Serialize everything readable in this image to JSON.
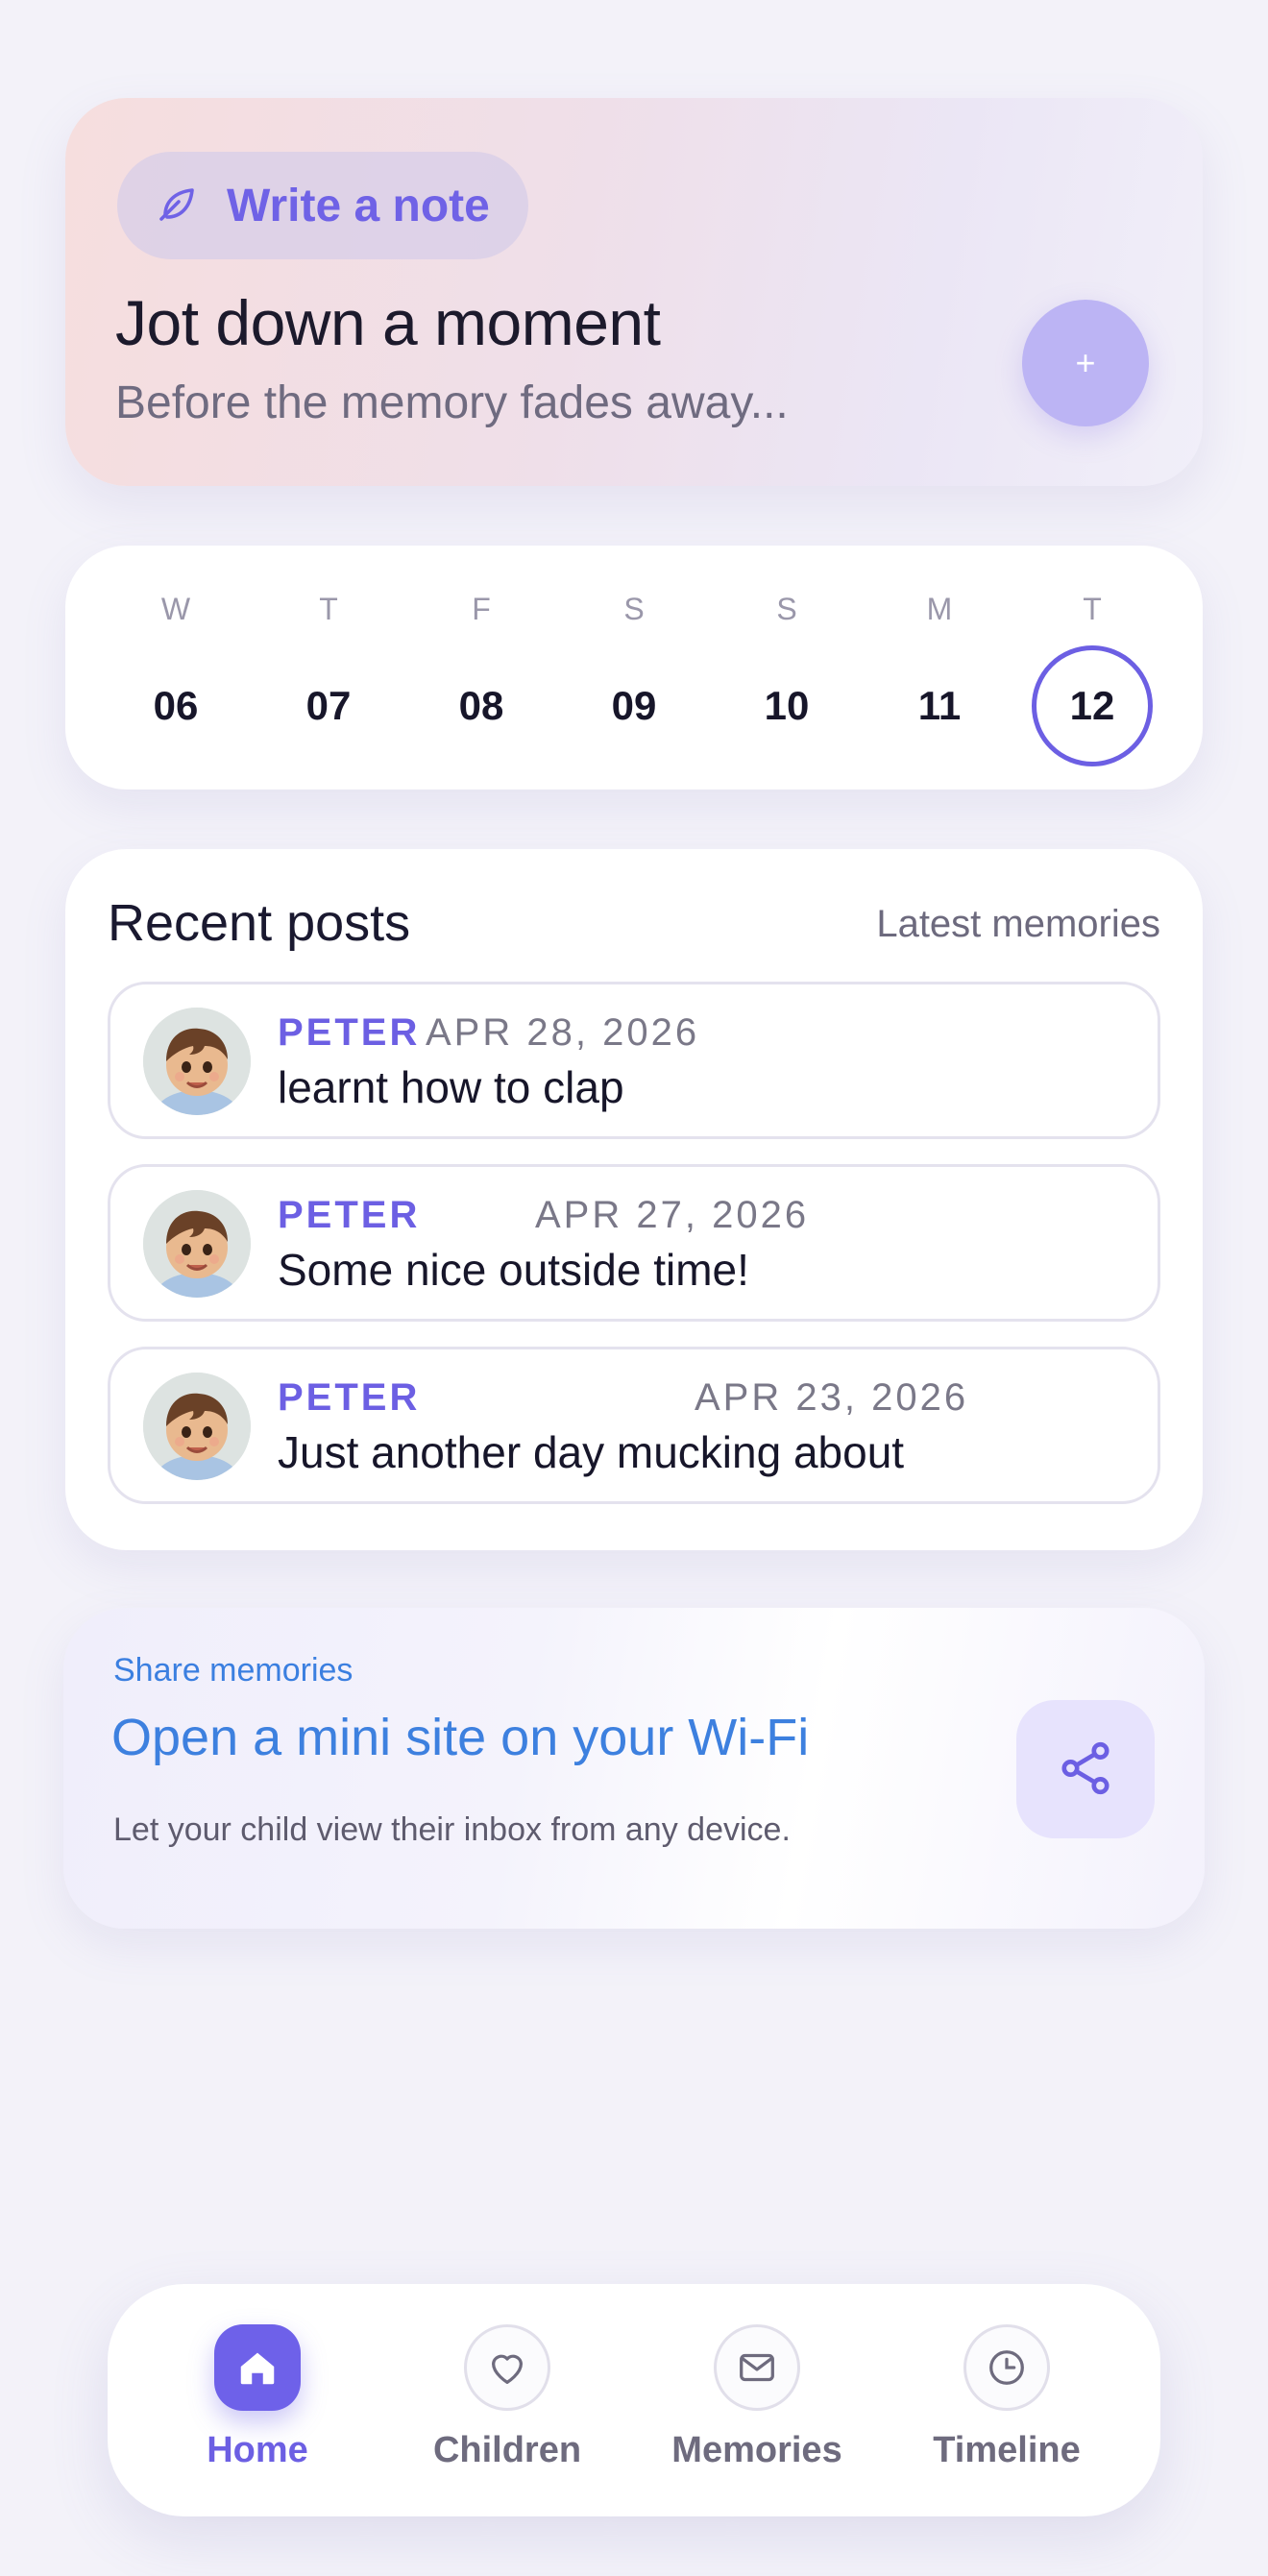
{
  "note_card": {
    "chip_label": "Write a note",
    "chip_icon": "leaf-icon",
    "title": "Jot down a moment",
    "subtitle": "Before the memory fades away...",
    "add_button": "+"
  },
  "week": {
    "days": [
      {
        "letter": "W",
        "date": "06"
      },
      {
        "letter": "T",
        "date": "07"
      },
      {
        "letter": "F",
        "date": "08"
      },
      {
        "letter": "S",
        "date": "09"
      },
      {
        "letter": "S",
        "date": "10"
      },
      {
        "letter": "M",
        "date": "11"
      },
      {
        "letter": "T",
        "date": "12"
      }
    ],
    "selected_date": "12"
  },
  "recent_posts": {
    "title": "Recent posts",
    "subtitle": "Latest memories",
    "items": [
      {
        "author": "PETER",
        "date": "APR 28, 2026",
        "text": "learnt how to clap"
      },
      {
        "author": "PETER",
        "date": "APR 27, 2026",
        "text": "Some nice outside time!"
      },
      {
        "author": "PETER",
        "date": "APR 23, 2026",
        "text": "Just another day mucking about"
      }
    ]
  },
  "share": {
    "eyebrow": "Share memories",
    "title": "Open a mini site on your Wi-Fi",
    "description": "Let your child view their inbox from any device.",
    "button_icon": "share-icon"
  },
  "nav": {
    "items": [
      {
        "label": "Home",
        "icon": "home-icon",
        "active": true
      },
      {
        "label": "Children",
        "icon": "heart-icon",
        "active": false
      },
      {
        "label": "Memories",
        "icon": "envelope-icon",
        "active": false
      },
      {
        "label": "Timeline",
        "icon": "clock-icon",
        "active": false
      }
    ]
  },
  "colors": {
    "accent": "#6c5fe3",
    "link_blue": "#3d80df",
    "background": "#f3f2f9"
  }
}
